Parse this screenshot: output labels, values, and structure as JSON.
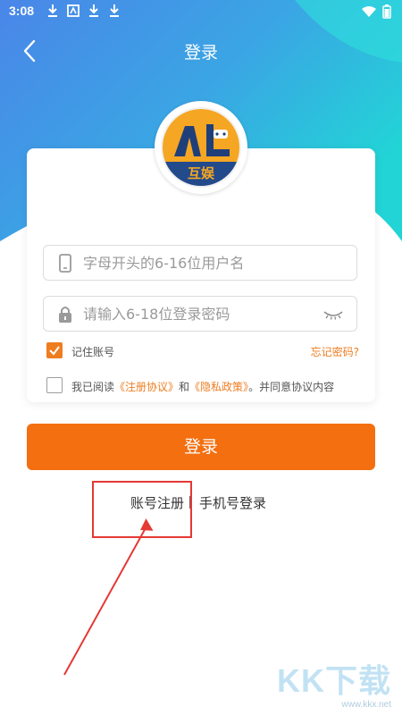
{
  "status_bar": {
    "time": "3:08"
  },
  "header": {
    "title": "登录"
  },
  "logo": {
    "text_top": "ΛL",
    "text_bottom": "互娱"
  },
  "form": {
    "username_placeholder": "字母开头的6-16位用户名",
    "password_placeholder": "请输入6-18位登录密码",
    "remember_label": "记住账号",
    "remember_checked": true,
    "forgot_label": "忘记密码?",
    "agreement": {
      "checked": false,
      "prefix": "我已阅读",
      "terms_link": "《注册协议》",
      "and": "和",
      "privacy_link": "《隐私政策》",
      "suffix": "。并同意协议内容"
    }
  },
  "actions": {
    "login_label": "登录",
    "register_label": "账号注册",
    "phone_login_label": "手机号登录"
  },
  "watermark": {
    "brand": "KK下载",
    "url": "www.kkx.net"
  },
  "colors": {
    "accent": "#f36f10",
    "header_gradient_start": "#4a8fe8",
    "header_gradient_end": "#2ad0d8",
    "annotation": "#e53935"
  }
}
